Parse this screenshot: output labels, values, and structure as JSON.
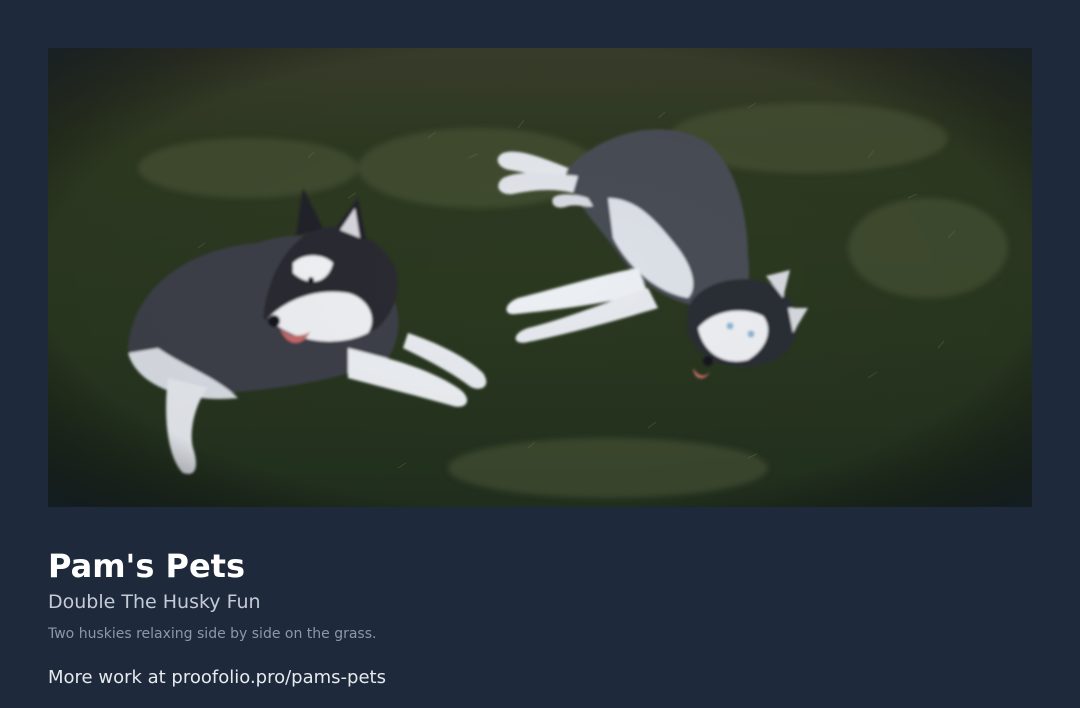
{
  "header": {
    "title": "Pam's Pets",
    "subtitle": "Double The Husky Fun"
  },
  "photo": {
    "caption": "Two huskies relaxing side by side on the grass.",
    "subject": "two-huskies-on-grass"
  },
  "footer": {
    "link_text": "More work at proofolio.pro/pams-pets"
  },
  "colors": {
    "page_background": "#1e2a3b",
    "grass": "#2c3a1f",
    "title": "#ffffff"
  }
}
